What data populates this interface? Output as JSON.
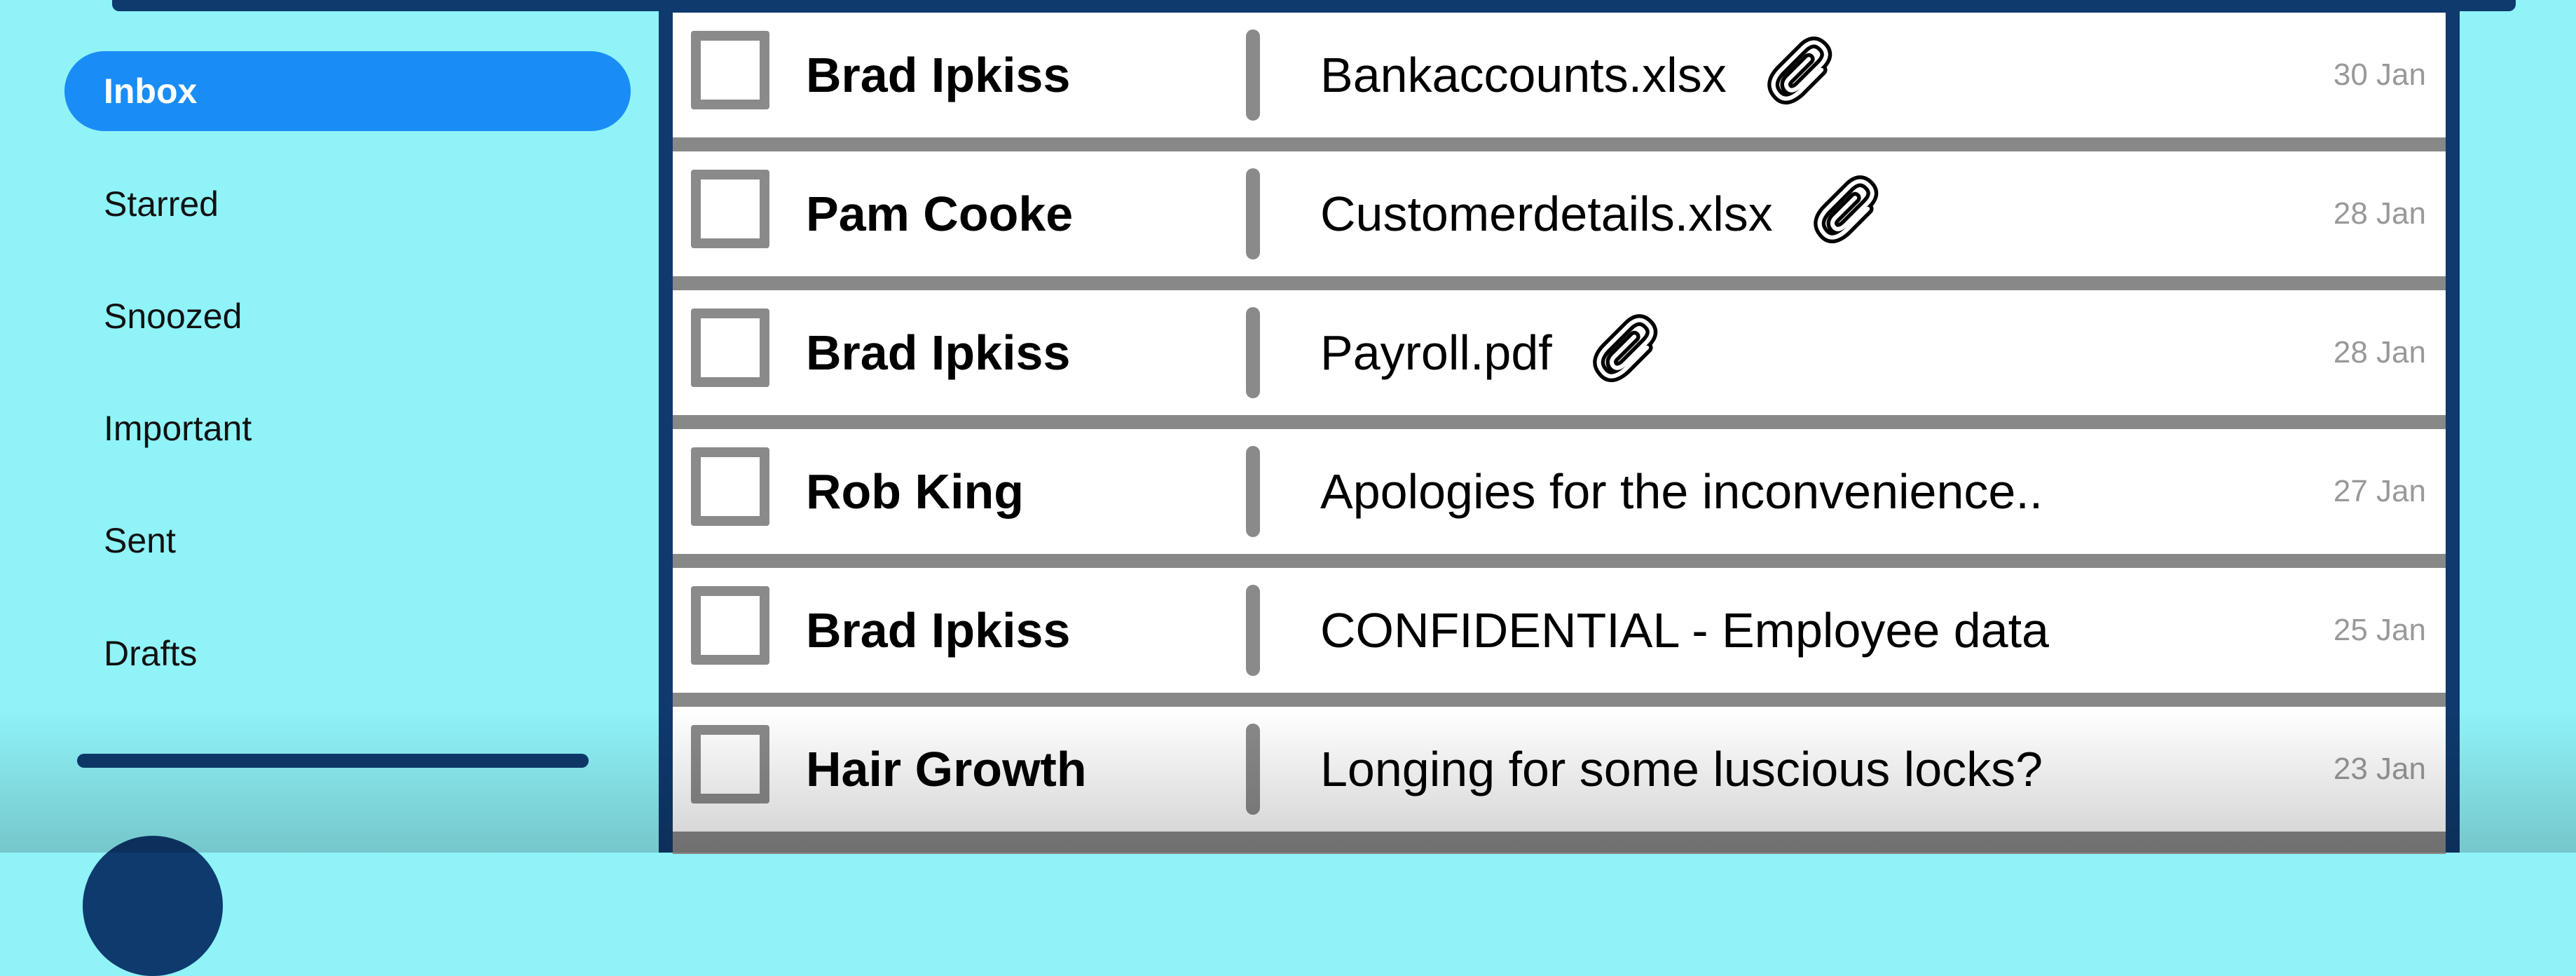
{
  "sidebar": {
    "items": [
      {
        "label": "Inbox",
        "active": true
      },
      {
        "label": "Starred"
      },
      {
        "label": "Snoozed"
      },
      {
        "label": "Important"
      },
      {
        "label": "Sent"
      },
      {
        "label": "Drafts"
      }
    ]
  },
  "emails": [
    {
      "sender": "Brad Ipkiss",
      "subject": "Bankaccounts.xlsx",
      "attachment": true,
      "date": "30 Jan"
    },
    {
      "sender": "Pam Cooke",
      "subject": "Customerdetails.xlsx",
      "attachment": true,
      "date": "28 Jan"
    },
    {
      "sender": "Brad Ipkiss",
      "subject": "Payroll.pdf",
      "attachment": true,
      "date": "28 Jan"
    },
    {
      "sender": "Rob King",
      "subject": "Apologies for the inconvenience..",
      "attachment": false,
      "date": "27 Jan"
    },
    {
      "sender": "Brad Ipkiss",
      "subject": "CONFIDENTIAL - Employee data",
      "attachment": false,
      "date": "25 Jan"
    },
    {
      "sender": "Hair Growth",
      "subject": "Longing for some luscious locks?",
      "attachment": false,
      "date": "23 Jan"
    }
  ],
  "icons": {
    "attachment": "paperclip-icon"
  },
  "colors": {
    "background": "#8ff3f8",
    "accent": "#1a8cf5",
    "frame": "#0e3a6e"
  }
}
